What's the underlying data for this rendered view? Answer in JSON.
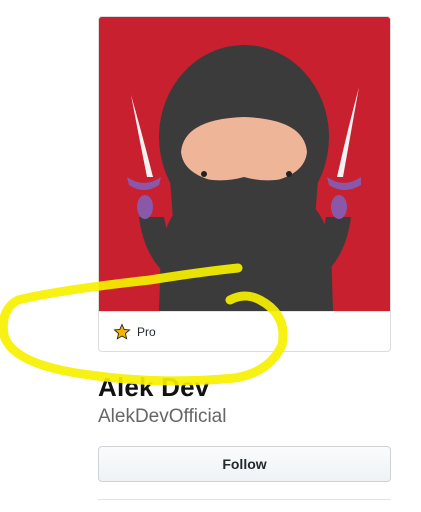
{
  "profile": {
    "avatar_description_icon": "ninja-avatar-icon",
    "badge": {
      "icon": "star-icon",
      "label": "Pro"
    },
    "fullname": "Alek Dev",
    "username": "AlekDevOfficial"
  },
  "actions": {
    "follow_label": "Follow"
  },
  "colors": {
    "avatar_bg": "#c8202f",
    "highlight": "#f6f000",
    "star": "#f5b400"
  }
}
